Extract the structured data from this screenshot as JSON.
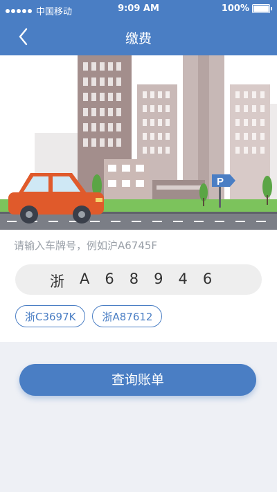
{
  "status_bar": {
    "carrier": "中国移动",
    "time": "9:09 AM",
    "battery": "100%"
  },
  "header": {
    "title": "缴费"
  },
  "illustration": {
    "parking_sign": "P"
  },
  "plate_input": {
    "hint": "请输入车牌号，例如沪A6745F",
    "chars": [
      "浙",
      "A",
      "6",
      "8",
      "9",
      "4",
      "6"
    ]
  },
  "history": [
    "浙C3697K",
    "浙A87612"
  ],
  "actions": {
    "query_label": "查询账单"
  },
  "colors": {
    "primary": "#4a7ec4",
    "car": "#e05a2b",
    "grass": "#7cc35c"
  }
}
